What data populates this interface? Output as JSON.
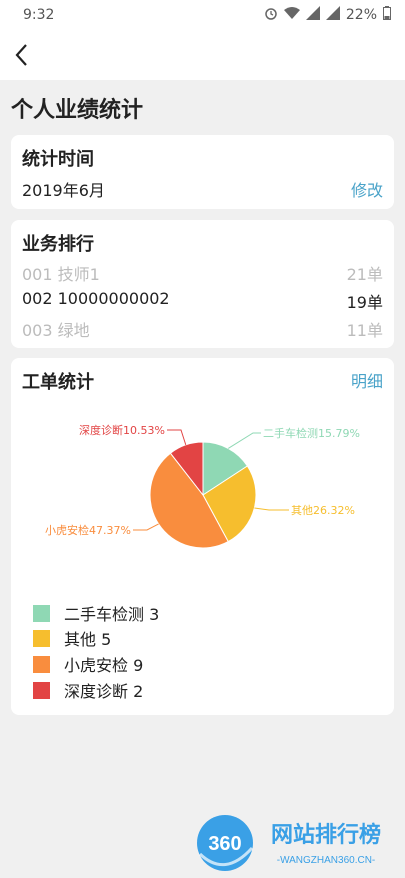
{
  "status_bar": {
    "time": "9:32",
    "battery": "22%"
  },
  "page_title": "个人业绩统计",
  "stat_time": {
    "title": "统计时间",
    "value": "2019年6月",
    "modify_label": "修改"
  },
  "business_rank": {
    "title": "业务排行",
    "rows": [
      {
        "name": "001 技师1",
        "count": "21单"
      },
      {
        "name": "002 10000000002",
        "count": "19单"
      },
      {
        "name": "003 绿地",
        "count": "11单"
      }
    ]
  },
  "work_orders": {
    "title": "工单统计",
    "detail_label": "明细",
    "legend": [
      {
        "label": "二手车检测 3",
        "color": "#8fd8b4"
      },
      {
        "label": "其他 5",
        "color": "#f6be2e"
      },
      {
        "label": "小虎安检 9",
        "color": "#f98d3e"
      },
      {
        "label": "深度诊断 2",
        "color": "#e24444"
      }
    ]
  },
  "chart_data": {
    "type": "pie",
    "slices": [
      {
        "name": "二手车检测",
        "value": 3,
        "label": "二手车检测15.79%",
        "color": "#8fd8b4"
      },
      {
        "name": "其他",
        "value": 5,
        "label": "其他26.32%",
        "color": "#f6be2e"
      },
      {
        "name": "小虎安检",
        "value": 9,
        "label": "小虎安检47.37%",
        "color": "#f98d3e"
      },
      {
        "name": "深度诊断",
        "value": 2,
        "label": "深度诊断10.53%",
        "color": "#e24444"
      }
    ]
  },
  "watermark": {
    "number": "360",
    "text": "网站排行榜",
    "sub": "-WANGZHAN360.CN-"
  }
}
